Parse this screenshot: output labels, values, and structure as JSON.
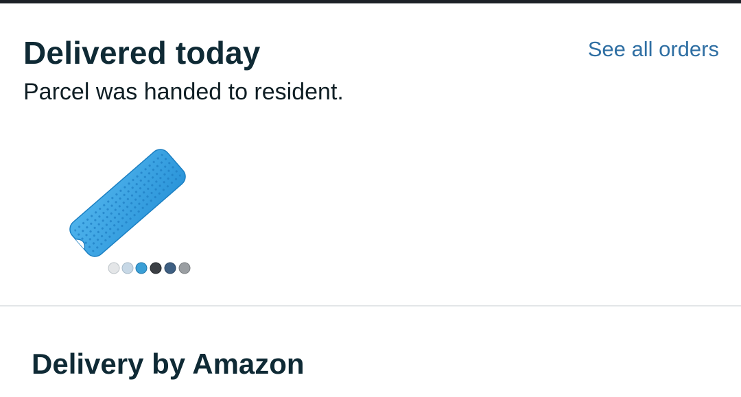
{
  "delivery": {
    "status_title": "Delivered today",
    "status_detail": "Parcel was handed to resident.",
    "see_all_link": "See all orders",
    "product_image_icon": "blue-bath-mat-image",
    "swatch_colors": [
      "#e4e6e8",
      "#c7d8e6",
      "#3a9fd6",
      "#3b3f44",
      "#3e5f82",
      "#9a9ea2"
    ]
  },
  "section": {
    "title": "Delivery by Amazon"
  },
  "colors": {
    "link": "#2f6fa3",
    "heading": "#0f2a35",
    "top_bar": "#1d2127",
    "divider": "#e3e6e8"
  }
}
